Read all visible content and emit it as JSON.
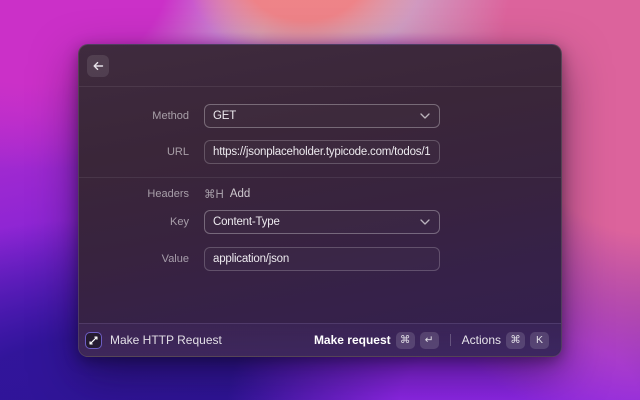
{
  "window": {
    "form": {
      "method": {
        "label": "Method",
        "value": "GET"
      },
      "url": {
        "label": "URL",
        "value": "https://jsonplaceholder.typicode.com/todos/1"
      },
      "headers": {
        "label": "Headers",
        "shortcut": "⌘H",
        "action_label": "Add"
      },
      "key": {
        "label": "Key",
        "value": "Content-Type"
      },
      "value": {
        "label": "Value",
        "value": "application/json"
      }
    },
    "footer": {
      "app_name": "Make HTTP Request",
      "primary_action": {
        "label": "Make request",
        "keys": [
          "⌘",
          "↵"
        ]
      },
      "secondary_action": {
        "label": "Actions",
        "keys": [
          "⌘",
          "K"
        ]
      }
    }
  },
  "icons": {
    "back": "arrow-left",
    "dropdown": "chevron-down",
    "app": "http-request-arrows"
  },
  "colors": {
    "window_background": "#3a2640",
    "wallpaper_magenta": "#c42fc4",
    "wallpaper_pink": "#dc639c",
    "wallpaper_coral": "#f08084",
    "wallpaper_violet": "#7b1fd6",
    "wallpaper_indigo": "#2d1492",
    "focused_field_border": "rgba(255,255,255,0.55)"
  }
}
